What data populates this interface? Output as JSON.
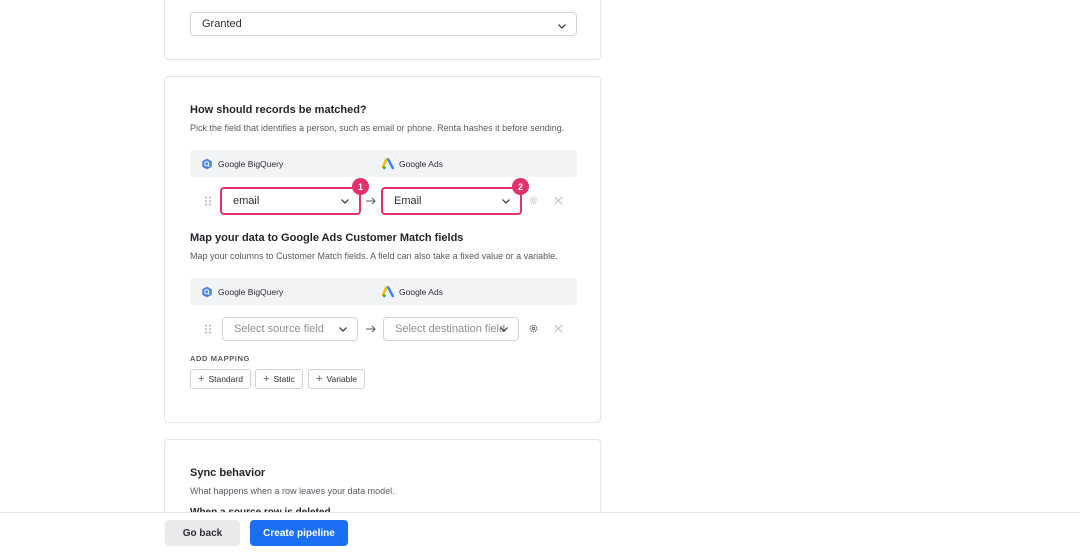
{
  "consent": {
    "value": "Granted"
  },
  "match": {
    "title": "How should records be matched?",
    "subtitle": "Pick the field that identifies a person, such as email or phone. Renta hashes it before sending.",
    "source_label": "Google BigQuery",
    "destination_label": "Google Ads",
    "source_value": "email",
    "destination_value": "Email",
    "badge_1": "1",
    "badge_2": "2"
  },
  "mapping": {
    "title": "Map your data to Google Ads Customer Match fields",
    "subtitle": "Map your columns to Customer Match fields. A field can also take a fixed value or a variable.",
    "source_label": "Google BigQuery",
    "destination_label": "Google Ads",
    "source_placeholder": "Select source field",
    "destination_placeholder": "Select destination field",
    "add_mapping_label": "ADD MAPPING",
    "buttons": {
      "standard": "Standard",
      "static": "Static",
      "variable": "Variable"
    }
  },
  "sync": {
    "title": "Sync behavior",
    "subtitle": "What happens when a row leaves your data model.",
    "partial_heading": "When a source row is deleted"
  },
  "footer": {
    "back_label": "Go back",
    "create_label": "Create pipeline"
  },
  "colors": {
    "accent": "#1a6ff2",
    "highlight": "#e5316b"
  }
}
